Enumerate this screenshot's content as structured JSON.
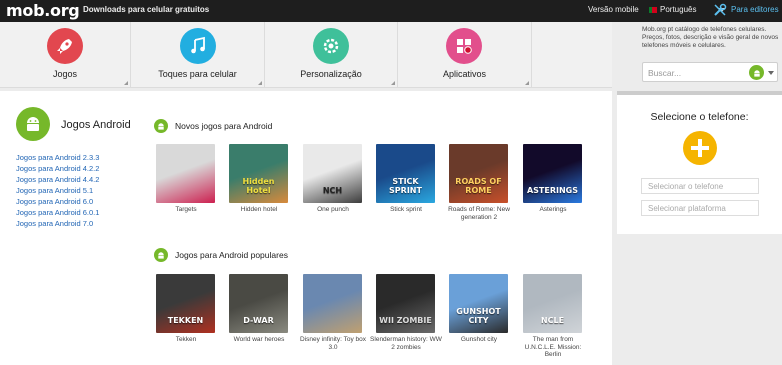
{
  "topbar": {
    "logo": "mob.org",
    "tagline": "Downloads para celular gratuitos",
    "mobile_version": "Versão mobile",
    "language": "Português",
    "editors": "Para editores"
  },
  "categories": [
    {
      "label": "Jogos",
      "icon": "rocket-icon",
      "color": "#e2474f"
    },
    {
      "label": "Toques para celular",
      "icon": "music-note-icon",
      "color": "#22aee0"
    },
    {
      "label": "Personalização",
      "icon": "gear-icon",
      "color": "#3fc09a"
    },
    {
      "label": "Aplicativos",
      "icon": "apps-grid-icon",
      "color": "#e24f8c"
    }
  ],
  "sidebar": {
    "description": "Mob.org pt catálogo de telefones celulares. Preços, fotos, descrição e visão geral de novos telefones móveis e celulares.",
    "search_placeholder": "Buscar...",
    "select_phone_title": "Selecione o telefone:",
    "phone_field_placeholder": "Selecionar o telefone",
    "platform_field_placeholder": "Selecionar plataforma"
  },
  "main": {
    "title": "Jogos Android",
    "versions": [
      "Jogos para Android 2.3.3",
      "Jogos para Android 4.2.2",
      "Jogos para Android 4.4.2",
      "Jogos para Android 5.1",
      "Jogos para Android 6.0",
      "Jogos para Android 6.0.1",
      "Jogos para Android 7.0"
    ],
    "new_section_title": "Novos jogos para Android",
    "new_games": [
      {
        "name": "Targets",
        "bg": "#d9d9d9",
        "accent": "#cc1f4f",
        "text": "",
        "text_color": "#fff"
      },
      {
        "name": "Hidden hotel",
        "bg": "#3a7d6b",
        "accent": "#d88a3c",
        "text": "Hidden Hotel",
        "text_color": "#f0e040"
      },
      {
        "name": "One punch",
        "bg": "#e9e9e9",
        "accent": "#3c3c3c",
        "text": "NCH",
        "text_color": "#222"
      },
      {
        "name": "Stick sprint",
        "bg": "#1a4a8a",
        "accent": "#2aa8e0",
        "text": "STICK SPRINT",
        "text_color": "#fff"
      },
      {
        "name": "Roads of Rome: New generation 2",
        "bg": "#6a3a2a",
        "accent": "#c8502a",
        "text": "ROADS OF ROME",
        "text_color": "#ffd060"
      },
      {
        "name": "Asterings",
        "bg": "#120a2a",
        "accent": "#2a7ae0",
        "text": "ASTERINGS",
        "text_color": "#fff"
      }
    ],
    "popular_section_title": "Jogos para Android populares",
    "popular_games": [
      {
        "name": "Tekken",
        "bg": "#3a3a3a",
        "accent": "#b03020",
        "text": "TEKKEN",
        "text_color": "#fff"
      },
      {
        "name": "World war heroes",
        "bg": "#4a4a44",
        "accent": "#8a8a80",
        "text": "D-WAR",
        "text_color": "#fff"
      },
      {
        "name": "Disney infinity: Toy box 3.0",
        "bg": "#6a88b0",
        "accent": "#c0a070",
        "text": "",
        "text_color": "#fff"
      },
      {
        "name": "Slenderman history: WW 2 zombies",
        "bg": "#2a2a2a",
        "accent": "#6a6a6a",
        "text": "WII ZOMBIE",
        "text_color": "#ddd"
      },
      {
        "name": "Gunshot city",
        "bg": "#6aa0d8",
        "accent": "#2a2a2a",
        "text": "GUNSHOT CITY",
        "text_color": "#fff"
      },
      {
        "name": "The man from U.N.C.L.E. Mission: Berlin",
        "bg": "#b0b8c0",
        "accent": "#d0d4d8",
        "text": "NCLE",
        "text_color": "#fff"
      }
    ]
  }
}
